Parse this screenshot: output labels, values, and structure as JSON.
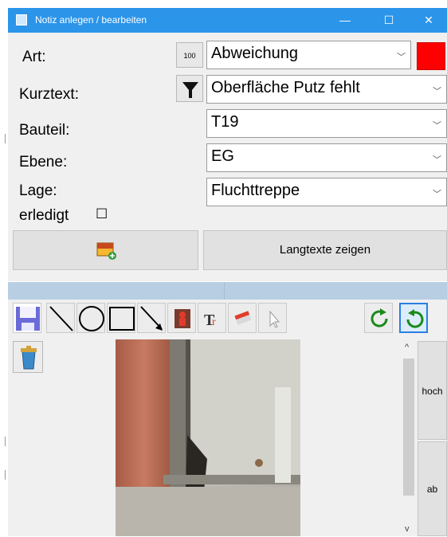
{
  "window": {
    "title": "Notiz anlegen / bearbeiten",
    "minimize": "—",
    "maximize": "☐",
    "close": "✕"
  },
  "form": {
    "art": {
      "label": "Art:",
      "icon_text": "100",
      "value": "Abweichung",
      "color": "#ff0000"
    },
    "kurztext": {
      "label": "Kurztext:",
      "value": "Oberfläche Putz fehlt"
    },
    "bauteil": {
      "label": "Bauteil:",
      "value": "T19"
    },
    "ebene": {
      "label": "Ebene:",
      "value": "EG"
    },
    "lage": {
      "label": "Lage:",
      "value": "Fluchttreppe"
    },
    "erledigt": {
      "label": "erledigt",
      "checked": false,
      "box": "☐"
    }
  },
  "buttons": {
    "add_image": "add-image-icon",
    "langtexte": "Langtexte zeigen"
  },
  "toolbar": {
    "tools": [
      "save-icon",
      "line-icon",
      "circle-icon",
      "rectangle-icon",
      "arrow-icon",
      "person-icon",
      "text-icon",
      "stamp-icon",
      "pointer-icon",
      "rotate-right-icon",
      "rotate-left-icon"
    ]
  },
  "side": {
    "hoch": "hoch",
    "ab": "ab",
    "scroll_up": "^",
    "scroll_down": "v"
  },
  "colors": {
    "titlebar": "#2b95ea",
    "divider": "#b8cfe3",
    "rotate_green": "#1a8a1a"
  }
}
